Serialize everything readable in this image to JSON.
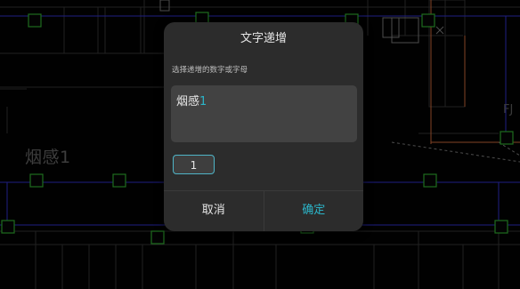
{
  "background": {
    "label_text": "烟感1",
    "fj_text": "FJ"
  },
  "dialog": {
    "title": "文字递增",
    "prompt": "选择递增的数字或字母",
    "text_prefix": "烟感",
    "text_digit": "1",
    "increment_value": "1",
    "cancel_label": "取消",
    "confirm_label": "确定"
  },
  "colors": {
    "accent": "#2bb5c9",
    "dialog_bg": "#2c2c2c",
    "field_bg": "#424242",
    "cad_grid": "#3a3a3a",
    "cad_blue": "#2e2ec8",
    "cad_orange": "#c8663a",
    "cad_green": "#2fa62f"
  }
}
